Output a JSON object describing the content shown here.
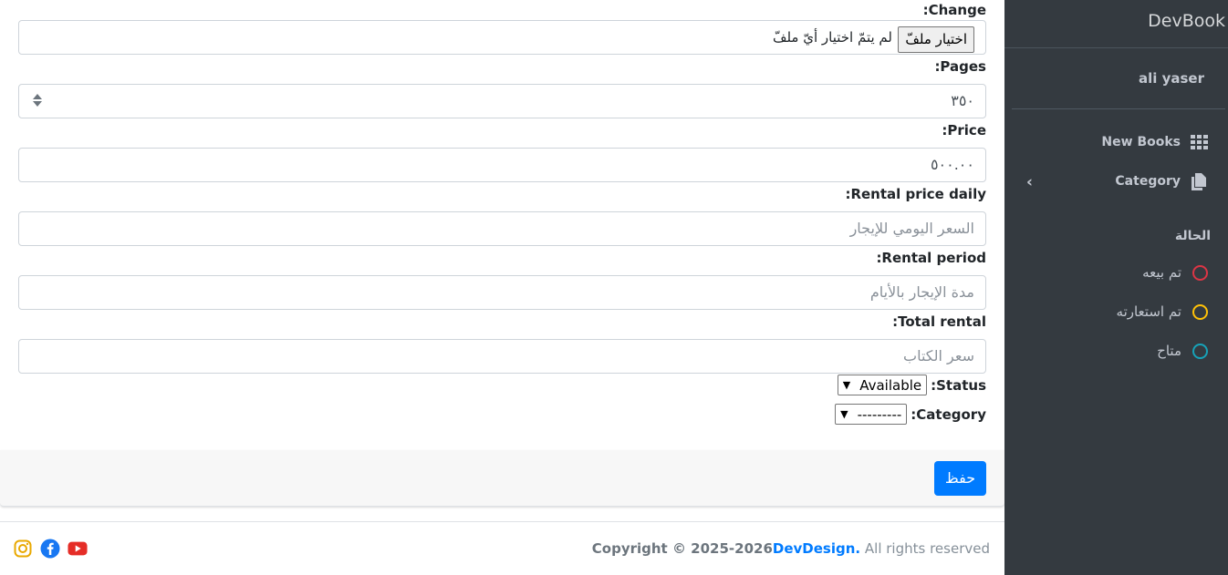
{
  "sidebar": {
    "brand": "DevBook",
    "user": "ali yaser",
    "nav": [
      {
        "label": "New Books",
        "icon": "grid-icon"
      },
      {
        "label": "Category",
        "icon": "copy-icon"
      }
    ],
    "status_title": "الحالة",
    "statuses": [
      {
        "label": "تم بيعه",
        "color": "#dc3545"
      },
      {
        "label": "تم استعارته",
        "color": "#ffc107"
      },
      {
        "label": "متاح",
        "color": "#17a2b8"
      }
    ]
  },
  "form": {
    "change_label": ":Change",
    "file_button": "اختيار ملفّ",
    "file_status": "لم يتمّ اختيار أيّ ملفّ",
    "pages_label": ":Pages",
    "pages_value": "٣٥٠",
    "price_label": ":Price",
    "price_value": "٥٠٠.٠٠",
    "rental_daily_label": ":Rental price daily",
    "rental_daily_placeholder": "السعر اليومي للإيجار",
    "rental_period_label": ":Rental period",
    "rental_period_placeholder": "مدة الإيجار بالأيام",
    "total_rental_label": ":Total rental",
    "total_rental_placeholder": "سعر الكتاب",
    "status_label": ":Status",
    "status_value": "Available",
    "category_label": ":Category",
    "category_value": "---------",
    "save_label": "حفظ"
  },
  "footer": {
    "copyright": "Copyright © 2025-2026",
    "brand": "DevDesign.",
    "rights": "All rights reserved"
  },
  "colors": {
    "sidebar_bg": "#343a40",
    "primary": "#007bff"
  }
}
